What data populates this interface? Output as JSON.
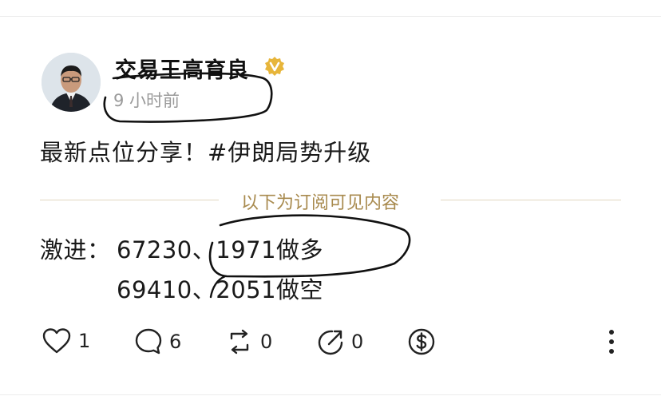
{
  "author": {
    "name": "交易王高育良",
    "verified": true
  },
  "post": {
    "timestamp": "9 小时前",
    "text": "最新点位分享！#伊朗局势升级",
    "paywall_label": "以下为订阅可见内容",
    "levels": {
      "label": "激进：",
      "line1": "67230、1971做多",
      "line2": "69410、2051做空"
    }
  },
  "actions": {
    "likes": "1",
    "comments": "6",
    "reposts": "0",
    "shares": "0"
  },
  "colors": {
    "verified_badge": "#e7b53a",
    "paywall_text": "#a88a4e",
    "annotation_ink": "#111111"
  }
}
